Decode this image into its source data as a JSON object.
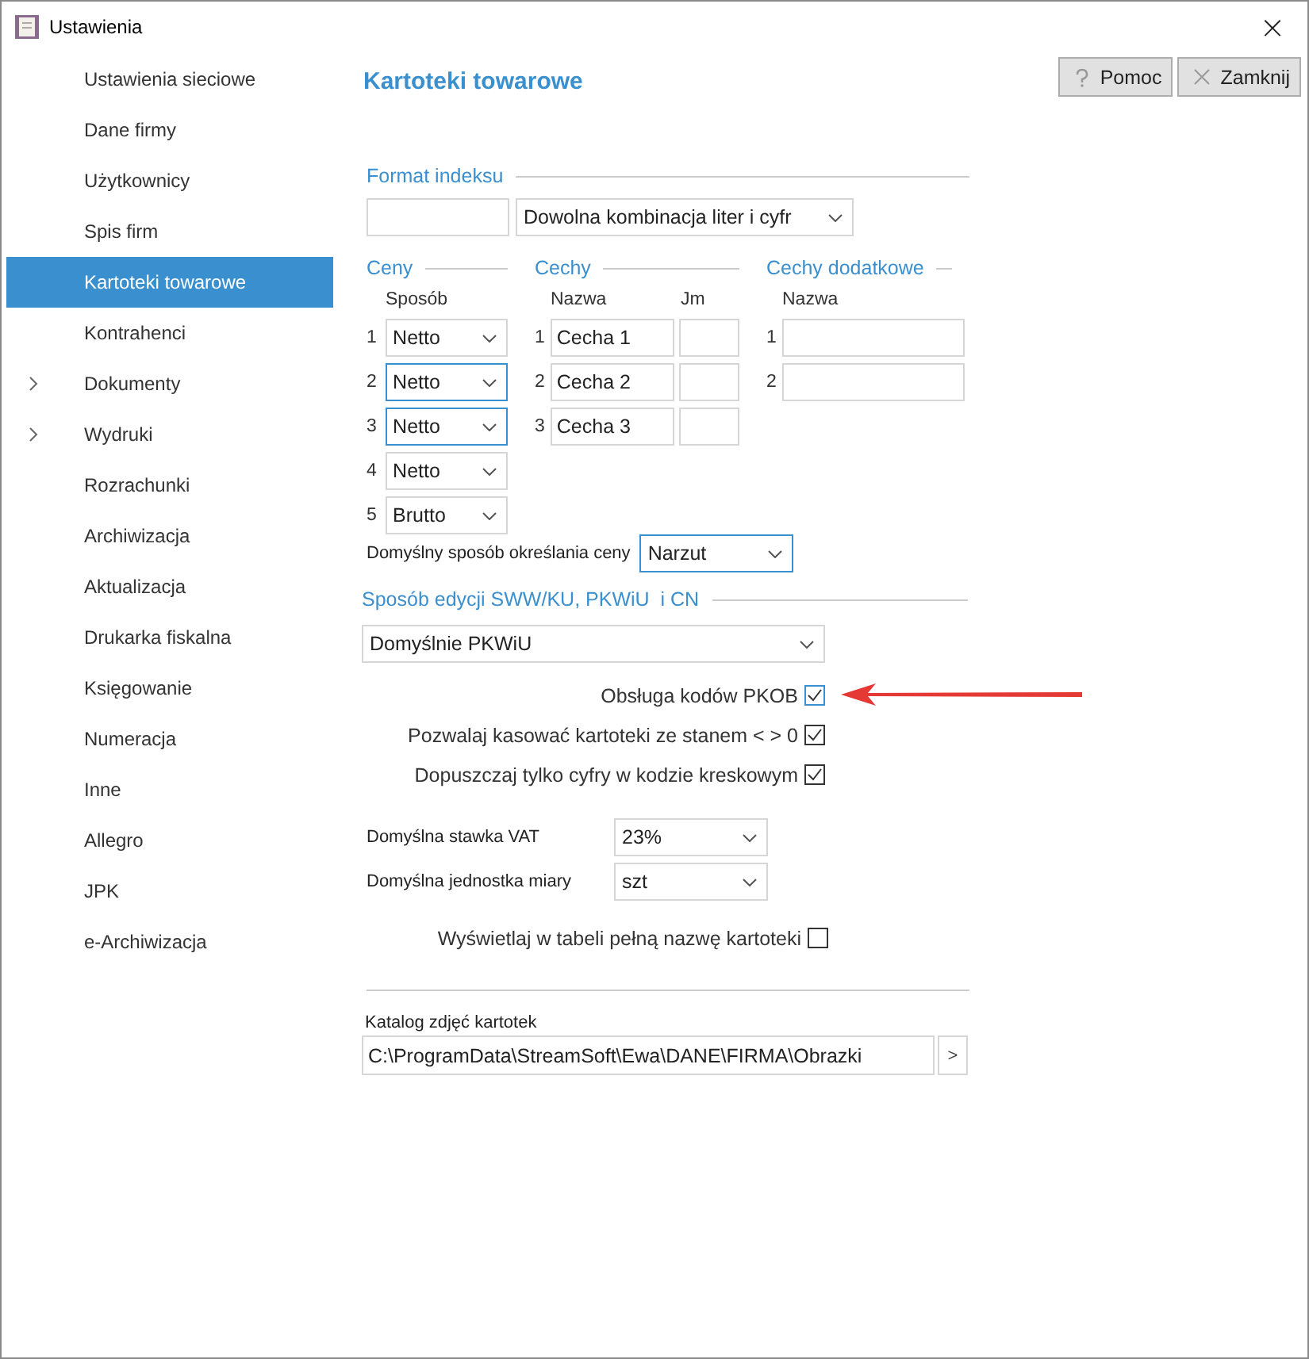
{
  "window": {
    "title": "Ustawienia",
    "close": "×"
  },
  "sidebar": {
    "items": [
      {
        "label": "Ustawienia sieciowe",
        "selected": false,
        "expandable": false
      },
      {
        "label": "Dane firmy",
        "selected": false,
        "expandable": false
      },
      {
        "label": "Użytkownicy",
        "selected": false,
        "expandable": false
      },
      {
        "label": "Spis firm",
        "selected": false,
        "expandable": false
      },
      {
        "label": "Kartoteki towarowe",
        "selected": true,
        "expandable": false
      },
      {
        "label": "Kontrahenci",
        "selected": false,
        "expandable": false
      },
      {
        "label": "Dokumenty",
        "selected": false,
        "expandable": true
      },
      {
        "label": "Wydruki",
        "selected": false,
        "expandable": true
      },
      {
        "label": "Rozrachunki",
        "selected": false,
        "expandable": false
      },
      {
        "label": "Archiwizacja",
        "selected": false,
        "expandable": false
      },
      {
        "label": "Aktualizacja",
        "selected": false,
        "expandable": false
      },
      {
        "label": "Drukarka fiskalna",
        "selected": false,
        "expandable": false
      },
      {
        "label": "Księgowanie",
        "selected": false,
        "expandable": false
      },
      {
        "label": "Numeracja",
        "selected": false,
        "expandable": false
      },
      {
        "label": "Inne",
        "selected": false,
        "expandable": false
      },
      {
        "label": "Allegro",
        "selected": false,
        "expandable": false
      },
      {
        "label": "JPK",
        "selected": false,
        "expandable": false
      },
      {
        "label": "e-Archiwizacja",
        "selected": false,
        "expandable": false
      }
    ]
  },
  "page_title": "Kartoteki towarowe",
  "buttons": [
    {
      "label": "Pomoc",
      "kind": "help"
    },
    {
      "label": "Zamknij",
      "kind": "close"
    }
  ],
  "format_indeksu": {
    "title": "Format indeksu",
    "mode": "Dowolna kombinacja liter i cyfr"
  },
  "ceny": {
    "title": "Ceny",
    "column": "Sposób",
    "rows": [
      {
        "number": "1",
        "value": "Netto",
        "focused": false
      },
      {
        "number": "2",
        "value": "Netto",
        "focused": true
      },
      {
        "number": "3",
        "value": "Netto",
        "focused": true
      },
      {
        "number": "4",
        "value": "Netto",
        "focused": false
      },
      {
        "number": "5",
        "value": "Brutto",
        "focused": false
      }
    ]
  },
  "cechy": {
    "title": "Cechy",
    "columns": [
      "Nazwa",
      "Jm"
    ],
    "rows": [
      {
        "number": "1",
        "name": "Cecha 1"
      },
      {
        "number": "2",
        "name": "Cecha 2"
      },
      {
        "number": "3",
        "name": "Cecha 3"
      }
    ]
  },
  "cechy_dodatkowe": {
    "title": "Cechy dodatkowe",
    "column": "Nazwa",
    "rows": [
      {
        "number": "1"
      },
      {
        "number": "2"
      }
    ]
  },
  "default_price_method": {
    "label": "Domyślny sposób określania ceny",
    "value": "Narzut"
  },
  "sww": {
    "title": "Sposób edycji SWW/KU, PKWiU  i CN",
    "value": "Domyślnie PKWiU"
  },
  "options": [
    {
      "label": "Obsługa kodów PKOB",
      "checked": true,
      "pointed": true
    },
    {
      "label": "Pozwalaj kasować kartoteki ze stanem < > 0",
      "checked": true,
      "pointed": false
    },
    {
      "label": "Dopuszczaj tylko cyfry w kodzie kreskowym",
      "checked": true,
      "pointed": false
    }
  ],
  "defaults": [
    {
      "label": "Domyślna stawka VAT",
      "value": "23%"
    },
    {
      "label": "Domyślna jednostka miary",
      "value": "szt"
    }
  ],
  "full_name_option": {
    "label": "Wyświetlaj w tabeli pełną nazwę kartoteki",
    "checked": false
  },
  "images_folder": {
    "label": "Katalog zdjęć kartotek",
    "value": "C:\\ProgramData\\StreamSoft\\Ewa\\DANE\\FIRMA\\Obrazki",
    "browse": ">"
  }
}
